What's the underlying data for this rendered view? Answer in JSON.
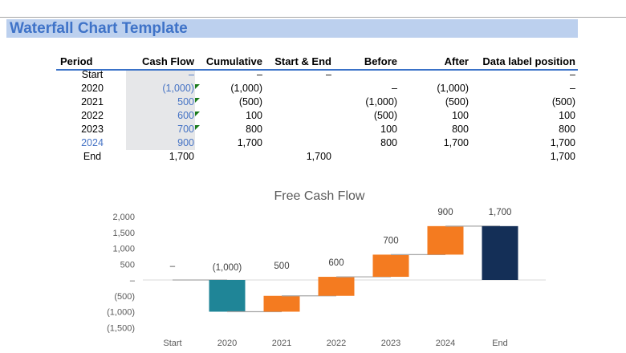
{
  "title": "Waterfall Chart Template",
  "table": {
    "headers": [
      "Period",
      "Cash Flow",
      "Cumulative",
      "Start & End",
      "Before",
      "After",
      "Data label position"
    ],
    "rows": [
      [
        "Start",
        "–",
        "–",
        "–",
        "",
        "",
        "–"
      ],
      [
        "2020",
        "(1,000)",
        "(1,000)",
        "",
        "–",
        "(1,000)",
        "–"
      ],
      [
        "2021",
        "500",
        "(500)",
        "",
        "(1,000)",
        "(500)",
        "(500)"
      ],
      [
        "2022",
        "600",
        "100",
        "",
        "(500)",
        "100",
        "100"
      ],
      [
        "2023",
        "700",
        "800",
        "",
        "100",
        "800",
        "800"
      ],
      [
        "2024",
        "900",
        "1,700",
        "",
        "800",
        "1,700",
        "1,700"
      ],
      [
        "End",
        "1,700",
        "",
        "1,700",
        "",
        "",
        "1,700"
      ]
    ]
  },
  "colors": {
    "negative": "#1f8597",
    "positive": "#f47b20",
    "total": "#142f57",
    "title": "#3f73c8"
  },
  "chart_data": {
    "type": "bar",
    "subtype": "waterfall",
    "title": "Free Cash Flow",
    "categories": [
      "Start",
      "2020",
      "2021",
      "2022",
      "2023",
      "2024",
      "End"
    ],
    "values": [
      0,
      -1000,
      500,
      600,
      700,
      900,
      1700
    ],
    "before": [
      0,
      0,
      -1000,
      -500,
      100,
      800,
      0
    ],
    "after": [
      0,
      -1000,
      -500,
      100,
      800,
      1700,
      1700
    ],
    "data_labels": [
      "–",
      "(1,000)",
      "500",
      "600",
      "700",
      "900",
      "1,700"
    ],
    "ylim": [
      -1500,
      2000
    ],
    "yticks": [
      2000,
      1500,
      1000,
      500,
      0,
      -500,
      -1000,
      -1500
    ],
    "ytick_labels": [
      "2,000",
      "1,500",
      "1,000",
      "500",
      "–",
      "(500)",
      "(1,000)",
      "(1,500)"
    ],
    "xlabel": "",
    "ylabel": "",
    "grid": false,
    "legend": "none"
  }
}
